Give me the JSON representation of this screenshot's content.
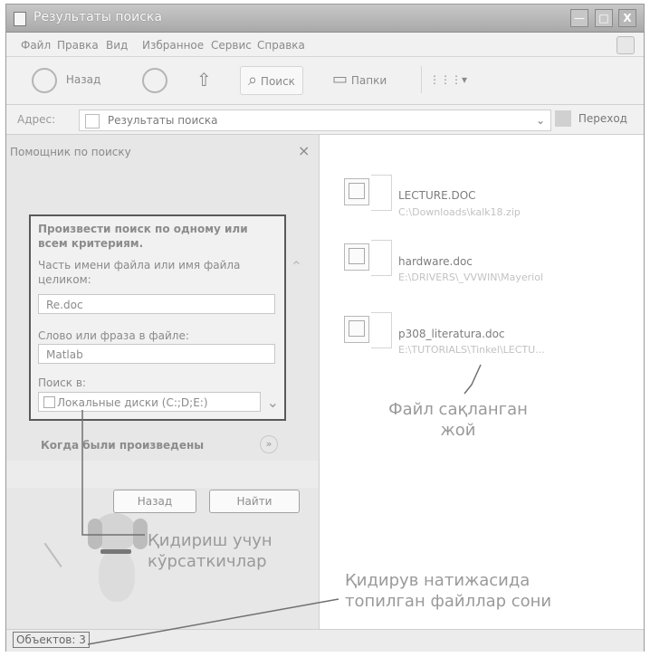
{
  "window": {
    "title": "Результаты поиска",
    "controls": [
      "—",
      "□",
      "X"
    ]
  },
  "menu": [
    "Файл",
    "Правка",
    "Вид",
    "Избранное",
    "Сервис",
    "Справка"
  ],
  "toolbar": {
    "back": "Назад",
    "search": "Поиск",
    "folders": "Папки",
    "view": "⋮⋮⋮▾"
  },
  "address_bar": {
    "label": "Адрес:",
    "value": "Результаты поиска",
    "go": "Переход"
  },
  "search_pane": {
    "header": "Помощник по поиску",
    "close": "×",
    "criteria_title": "Произвести поиск по одному или всем критериям.",
    "filename_label": "Часть имени файла или имя файла целиком:",
    "filename_value": "Re.doc",
    "phrase_label": "Слово или фраза в файле:",
    "phrase_value": "Matlab",
    "lookin_label": "Поиск в:",
    "lookin_value": "Локальные диски (C:;D;E:)",
    "when_modified": "Когда были произведены",
    "back_button": "Назад",
    "find_button": "Найти"
  },
  "results": [
    {
      "name": "LECTURE.DOC",
      "path": "C:\\Downloads\\kalk18.zip"
    },
    {
      "name": "hardware.doc",
      "path": "E:\\DRIVERS\\_VVWIN\\Mayeriol"
    },
    {
      "name": "p308_literatura.doc",
      "path": "E:\\TUTORIALS\\Tinkel\\LECTU..."
    }
  ],
  "annotations": {
    "file_location": [
      "Файл сақланган",
      "жой"
    ],
    "search_criteria": [
      "Қидириш учун",
      "кўрсаткичлар"
    ],
    "result_count": [
      "Қидирув натижасида",
      "топилган файллар сони"
    ]
  },
  "status_bar": {
    "text": "Объектов: 3"
  }
}
